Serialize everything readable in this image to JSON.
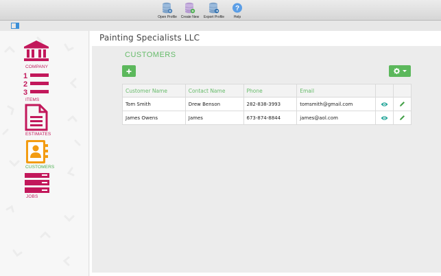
{
  "toolbar": {
    "open_profile": "Open Profile",
    "create_new": "Create New",
    "export_profile": "Export Profile",
    "help": "Help"
  },
  "company_name": "Painting Specialists LLC",
  "sidebar": {
    "items": [
      {
        "key": "company",
        "label": "COMPANY",
        "icon": "bank-icon"
      },
      {
        "key": "items",
        "label": "ITEMS",
        "icon": "numbered-list-icon"
      },
      {
        "key": "estimates",
        "label": "ESTIMATES",
        "icon": "document-icon"
      },
      {
        "key": "customers",
        "label": "CUSTOMERS",
        "icon": "contact-book-icon"
      },
      {
        "key": "jobs",
        "label": "JOBS",
        "icon": "stack-icon"
      }
    ],
    "active": "customers"
  },
  "section_title": "CUSTOMERS",
  "table": {
    "columns": [
      "Customer Name",
      "Contact Name",
      "Phone",
      "Email"
    ],
    "rows": [
      {
        "customer": "Tom Smith",
        "contact": "Drew Benson",
        "phone": "282-838-3993",
        "email": "tomsmith@gmail.com"
      },
      {
        "customer": "James Owens",
        "contact": "James",
        "phone": "673-874-8844",
        "email": "james@aol.com"
      }
    ]
  },
  "colors": {
    "accent_green": "#5cb85c",
    "title_green": "#66bb6a",
    "nav_pink": "#c2185b",
    "nav_orange": "#f39c12"
  }
}
